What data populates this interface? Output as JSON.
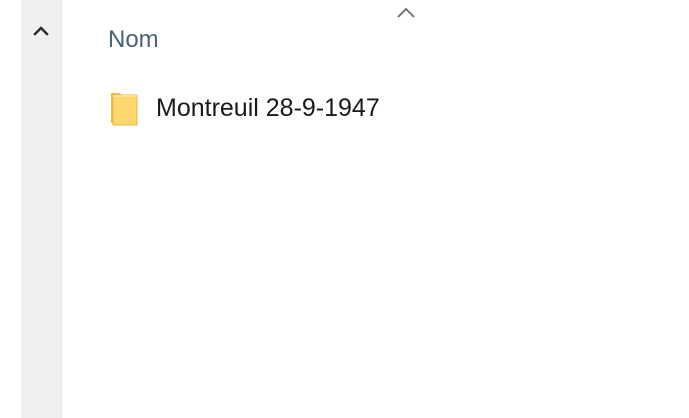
{
  "list": {
    "column_header": "Nom",
    "items": [
      {
        "name": "Montreuil 28-9-1947",
        "icon": "folder-icon"
      }
    ]
  },
  "icons": {
    "scroll_up": "chevron-up-icon",
    "sort": "sort-ascending-icon"
  },
  "colors": {
    "header_text": "#4c607a",
    "item_text": "#1a1a1a",
    "scroll_track": "#f0f0f0",
    "folder": "#ffd76e"
  }
}
